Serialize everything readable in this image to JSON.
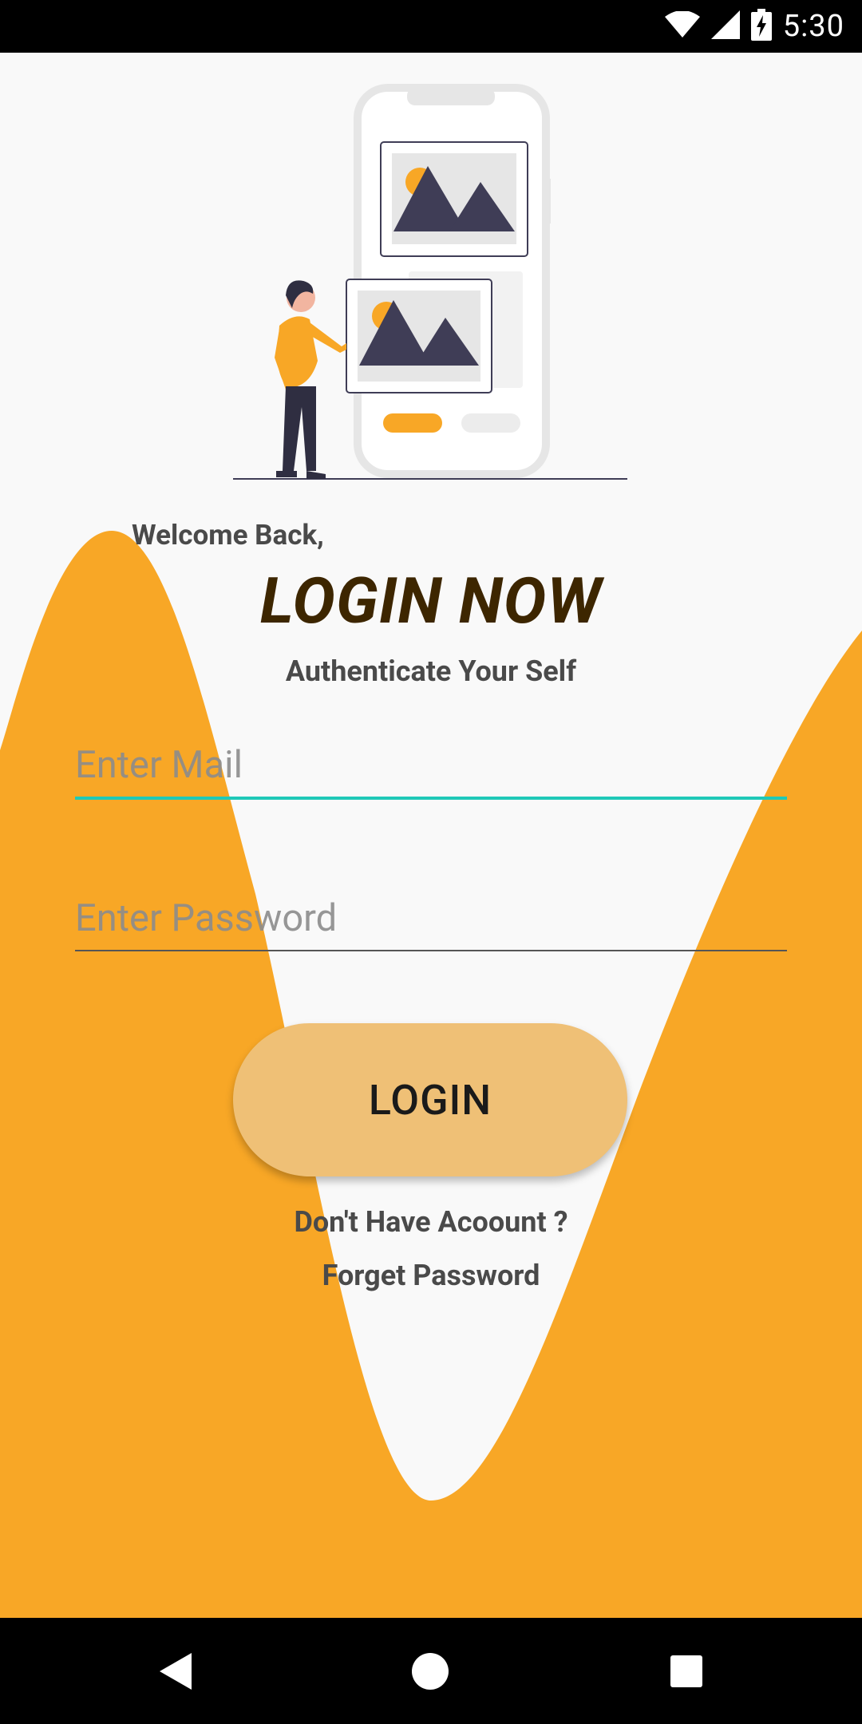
{
  "status_bar": {
    "time": "5:30",
    "icons": [
      "wifi-icon",
      "signal-icon",
      "battery-charging-icon"
    ]
  },
  "welcome_text": "Welcome Back,",
  "title": "LOGIN NOW",
  "subtitle": "Authenticate Your Self",
  "form": {
    "email_placeholder": "Enter Mail",
    "email_value": "",
    "password_placeholder": "Enter Password",
    "password_value": "",
    "login_label": "LOGIN"
  },
  "links": {
    "signup": "Don't Have Acoount ?",
    "forgot": "Forget Password"
  },
  "nav_bar": {
    "icons": [
      "back-icon",
      "home-icon",
      "recents-icon"
    ]
  },
  "colors": {
    "accent": "#f8a726",
    "button": "#efc076",
    "focused_underline": "#1fc9b8",
    "title": "#3d2600",
    "background": "#f9f9f9"
  }
}
